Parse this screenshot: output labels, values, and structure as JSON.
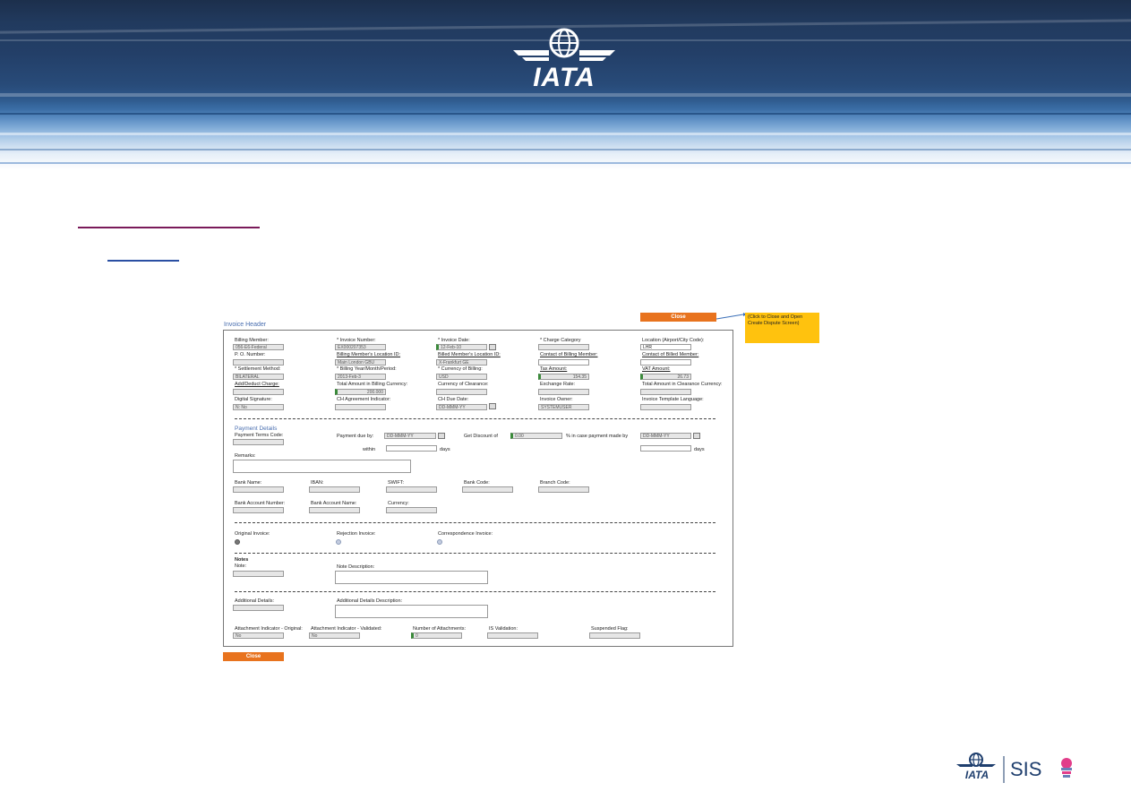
{
  "logo": {
    "text": "IATA"
  },
  "buttons": {
    "close_top": "Close",
    "close_bottom": "Close"
  },
  "callout": {
    "text": "(Click to Close and Open Create Dispute Screen)"
  },
  "panel_title": "Invoice Header",
  "header_fields": {
    "billing_member": {
      "label": "Billing Member:",
      "value": "056-E6-Federal"
    },
    "invoice_number": {
      "label": "* Invoice Number:",
      "value": "EX000207353"
    },
    "invoice_date": {
      "label": "* Invoice Date:",
      "value": "12-Feb-10"
    },
    "charge_category": {
      "label": "* Charge Category",
      "value": ""
    },
    "location": {
      "label": "Location (Airport/City Code):",
      "value": "LHR"
    },
    "po_number": {
      "label": "P. O. Number:",
      "value": ""
    },
    "billing_location": {
      "label": "Billing Member's Location ID:",
      "value": "Main London GBU"
    },
    "billed_location": {
      "label": "Billed Member's Location ID:",
      "value": "X-Frankfurt GE"
    },
    "contact_billing": {
      "label": "Contact of Billing Member:",
      "value": ""
    },
    "contact_billed": {
      "label": "Contact of Billed Member:",
      "value": ""
    },
    "settlement_method": {
      "label": "* Settlement Method:",
      "value": "BILATERAL"
    },
    "billing_period": {
      "label": "* Billing Year/Month/Period:",
      "value": "2013-Feb-3"
    },
    "currency_billing": {
      "label": "* Currency of Billing:",
      "value": "USD"
    },
    "tax_amount": {
      "label": "Tax Amount:",
      "value": "154.35"
    },
    "vat_amount": {
      "label": "VAT Amount:",
      "value": "26.73"
    },
    "add_deduct": {
      "label": "Add/Deduct Charge:",
      "value": ""
    },
    "total_billing": {
      "label": "Total Amount in Billing Currency:",
      "value": "200.000"
    },
    "currency_clearance": {
      "label": "Currency of Clearance:",
      "value": ""
    },
    "exchange_rate": {
      "label": "Exchange Rate:",
      "value": ""
    },
    "total_clearance": {
      "label": "Total Amount in Clearance Currency:",
      "value": ""
    },
    "digital_signature": {
      "label": "Digital Signature:",
      "value": "N: No"
    },
    "ch_agreement": {
      "label": "CH Agreement Indicator:",
      "value": ""
    },
    "ch_due_date": {
      "label": "CH Due Date:",
      "value": "DD-MMM-YY"
    },
    "invoice_owner": {
      "label": "Invoice Owner:",
      "value": "SYSTEMUSER"
    },
    "template_language": {
      "label": "Invoice Template Language:",
      "value": ""
    }
  },
  "payment": {
    "title": "Payment Details",
    "terms_code": "Payment Terms Code:",
    "due_by": "Payment due by:",
    "due_value": "DD-MMM-YY",
    "within": "within",
    "days": "days",
    "discount_label": "Get Discount of",
    "discount_value": "0.00",
    "pct_text": "% in case payment made by",
    "pct_date": "DD-MMM-YY",
    "days2": "days",
    "remarks": "Remarks:",
    "bank_name": "Bank Name:",
    "iban": "IBAN:",
    "swift": "SWIFT:",
    "bank_code": "Bank Code:",
    "branch_code": "Branch Code:",
    "bank_account_number": "Bank Account Number:",
    "bank_account_name": "Bank Account Name:",
    "currency": "Currency:"
  },
  "invoice_type": {
    "original": "Original Invoice:",
    "rejection": "Rejection Invoice:",
    "correspondence": "Correspondence Invoice:"
  },
  "notes": {
    "title": "Notes",
    "note": "Note:",
    "note_desc": "Note Description:"
  },
  "additional": {
    "details": "Additional Details:",
    "desc": "Additional Details Description:"
  },
  "attachments": {
    "orig": "Attachment Indicator - Original:",
    "orig_value": "No",
    "validated": "Attachment Indicator - Validated:",
    "validated_value": "No",
    "number": "Number of Attachments:",
    "number_value": "0",
    "is_validation": "IS Validation:",
    "suspended": "Suspended Flag:"
  },
  "footer": {
    "sis_text": "SIS",
    "iata_text": "IATA"
  }
}
